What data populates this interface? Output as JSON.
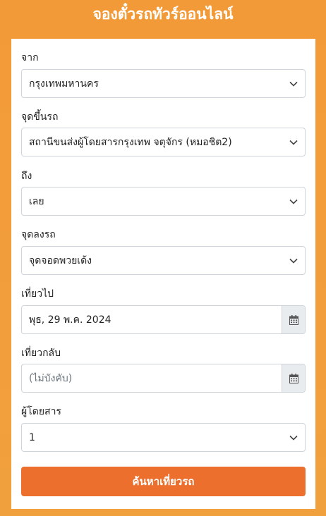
{
  "header": {
    "title": "จองตั๋วรถทัวร์ออนไลน์"
  },
  "form": {
    "from": {
      "label": "จาก",
      "value": "กรุงเทพมหานคร"
    },
    "boarding": {
      "label": "จุดขึ้นรถ",
      "value": "สถานีขนส่งผู้โดยสารกรุงเทพ จตุจักร (หมอชิต2)"
    },
    "to": {
      "label": "ถึง",
      "value": "เลย"
    },
    "dropoff": {
      "label": "จุดลงรถ",
      "value": "จุดจอดพวยเด้ง"
    },
    "depart": {
      "label": "เที่ยวไป",
      "value": "พุธ, 29 พ.ค. 2024"
    },
    "return": {
      "label": "เที่ยวกลับ",
      "placeholder": "(ไม่บังคับ)"
    },
    "passengers": {
      "label": "ผู้โดยสาร",
      "value": "1"
    },
    "search_button": "ค้นหาเที่ยวรถ"
  },
  "icons": {
    "calendar": "calendar-icon",
    "chevron": "chevron-down-icon"
  },
  "colors": {
    "background": "#f39a38",
    "button": "#ec6f2d",
    "addon": "#e9ecef"
  }
}
